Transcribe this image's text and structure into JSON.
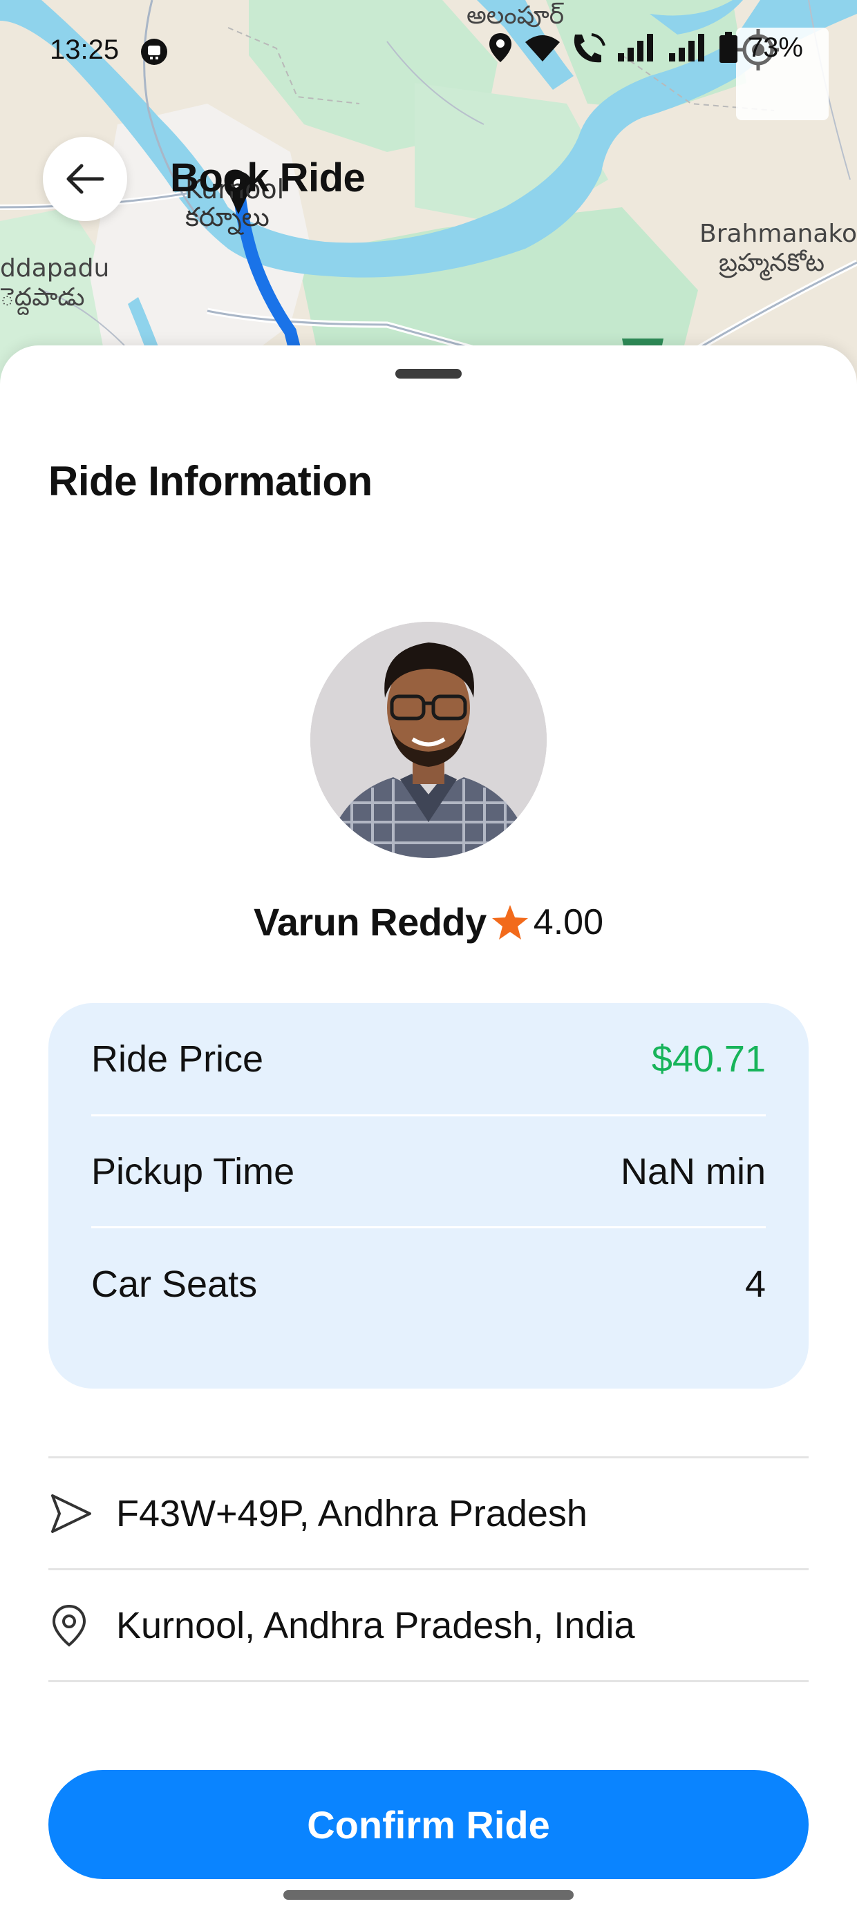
{
  "status_bar": {
    "time": "13:25",
    "battery_percent": "73%"
  },
  "map": {
    "labels": {
      "alampur": "అలంపూర్",
      "kurnool_en": "Kurnool",
      "kurnool_te": "కర్నూలు",
      "brahmanakotkur_en": "Brahmanako",
      "brahmanakotkur_te": "బ్రహ్మనకోట",
      "peddapadu_en": "ddapadu",
      "peddapadu_te": "ెద్దపాడు"
    }
  },
  "header": {
    "title": "Book Ride"
  },
  "sheet": {
    "section_title": "Ride Information",
    "driver": {
      "name": "Varun Reddy",
      "rating": "4.00"
    },
    "info": {
      "ride_price_label": "Ride Price",
      "ride_price_value": "$40.71",
      "pickup_time_label": "Pickup Time",
      "pickup_time_value": "NaN min",
      "car_seats_label": "Car Seats",
      "car_seats_value": "4"
    },
    "pickup_address": "F43W+49P, Andhra Pradesh",
    "destination_address": "Kurnool, Andhra Pradesh, India",
    "confirm_label": "Confirm Ride"
  },
  "colors": {
    "primary": "#0a84ff",
    "price_green": "#17b45a",
    "card_bg": "#e5f1fd",
    "star": "#f26a1b",
    "route": "#1a73e8"
  },
  "icons": {
    "back": "arrow-left-icon",
    "locate": "my-location-icon",
    "star": "star-icon",
    "pickup": "navigation-arrow-icon",
    "destination": "map-pin-icon"
  }
}
